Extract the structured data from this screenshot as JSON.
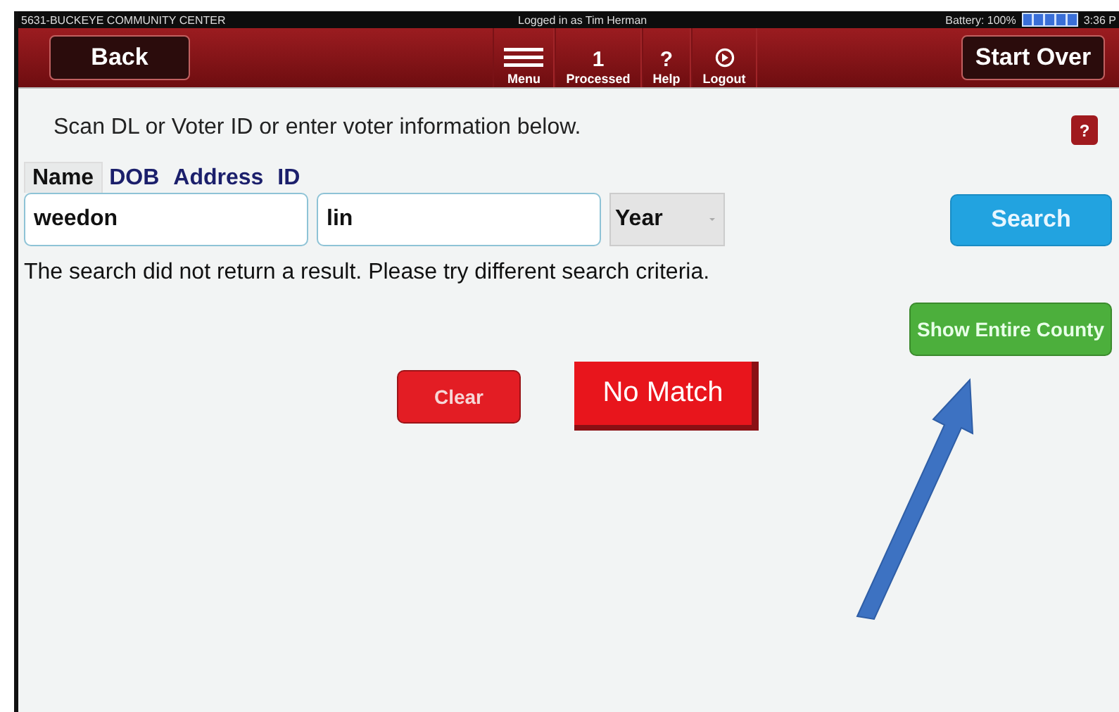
{
  "status_bar": {
    "location": "5631-BUCKEYE COMMUNITY CENTER",
    "user": "Logged in as Tim Herman",
    "battery": "Battery: 100%",
    "time": "3:36 P"
  },
  "toolbar": {
    "back": "Back",
    "start_over": "Start Over",
    "items": [
      {
        "kind": "menu",
        "label": "Menu"
      },
      {
        "kind": "count",
        "value": "1",
        "label": "Processed"
      },
      {
        "kind": "help",
        "value": "?",
        "label": "Help"
      },
      {
        "kind": "logout",
        "label": "Logout"
      }
    ]
  },
  "instructions": "Scan DL or Voter ID or enter voter information below.",
  "help_badge": "?",
  "tabs": [
    {
      "label": "Name",
      "selected": true
    },
    {
      "label": "DOB",
      "selected": false
    },
    {
      "label": "Address",
      "selected": false
    },
    {
      "label": "ID",
      "selected": false
    }
  ],
  "fields": [
    {
      "value": "weedon"
    },
    {
      "value": "lin"
    }
  ],
  "year_select": {
    "value": "Year"
  },
  "search_button": "Search",
  "message": "The search did not return a result. Please try different search criteria.",
  "show_county_button": "Show Entire County",
  "clear_button": "Clear",
  "no_match_button": "No Match"
}
